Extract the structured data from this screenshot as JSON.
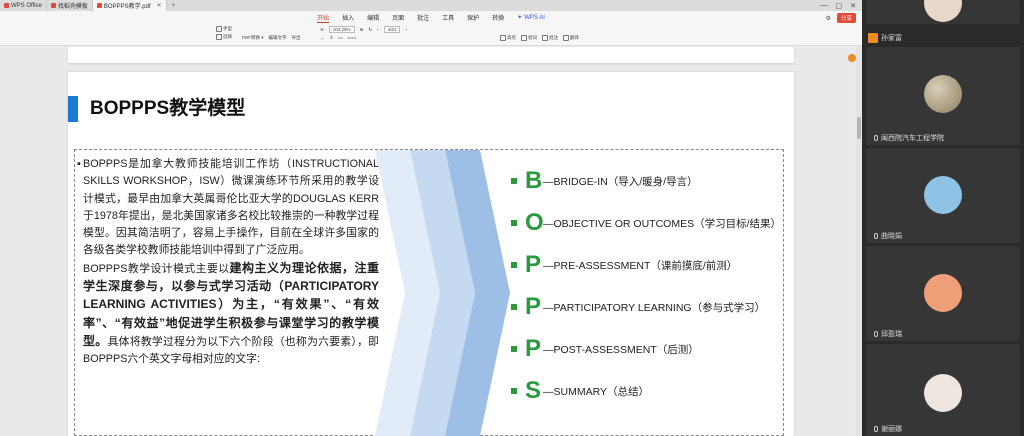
{
  "tabs": [
    {
      "label": "WPS Office",
      "color": "#e24a3a",
      "active": false
    },
    {
      "label": "找稻壳模板",
      "color": "#e24a3a",
      "active": false
    },
    {
      "label": "BOPPPS教学.pdf",
      "color": "#e24a3a",
      "active": true
    }
  ],
  "menu": {
    "items": [
      "开始",
      "插入",
      "编辑",
      "页面",
      "批注",
      "工具",
      "保护",
      "转换"
    ],
    "active": "开始",
    "ai_label": "WPS AI",
    "share_label": "分享"
  },
  "toolbar": {
    "zoom": "103.29%",
    "page": "4/21",
    "labels": [
      "手型",
      "选择",
      "PDF转换",
      "编辑文字",
      "高亮",
      "划词",
      "批注",
      "导出",
      "翻译"
    ]
  },
  "document": {
    "title": "BOPPPS教学模型",
    "paragraph1": "BOPPPS是加拿大教师技能培训工作坊（INSTRUCTIONAL SKILLS WORKSHOP，ISW）微课演练环节所采用的教学设计模式，最早由加拿大英属哥伦比亚大学的DOUGLAS KERR于1978年提出，是北美国家诸多名校比较推崇的一种教学过程模型。因其简洁明了，容易上手操作，目前在全球许多国家的各级各类学校教师技能培训中得到了广泛应用。",
    "paragraph2_lead": "BOPPPS教学设计模式主要以",
    "paragraph2_bold": "建构主义为理论依据，注重学生深度参与，以参与式学习活动（PARTICIPATORY LEARNING ACTIVITIES）为主，“有效果”、“有效率”、“有效益”地促进学生积极参与课堂学习的教学模型。",
    "paragraph2_tail": "具体将教学过程分为以下六个阶段（也称为六要素），即BOPPPS六个英文字母相对应的文字:",
    "stages": [
      {
        "letter": "B",
        "desc": "—BRIDGE-IN（导入/暖身/导言）"
      },
      {
        "letter": "O",
        "desc": "—OBJECTIVE OR OUTCOMES（学习目标/结果）"
      },
      {
        "letter": "P",
        "desc": "—PRE-ASSESSMENT（课前摸底/前测）"
      },
      {
        "letter": "P",
        "desc": "—PARTICIPATORY LEARNING（参与式学习）"
      },
      {
        "letter": "P",
        "desc": "—POST-ASSESSMENT（后测）"
      },
      {
        "letter": "S",
        "desc": "—SUMMARY（总结）"
      }
    ],
    "accent_color": "#2a9a3f",
    "title_bar_color": "#1b7bd0"
  },
  "participants": {
    "self_label": "孙家富",
    "tiles": [
      {
        "name": "",
        "avatar": "portrait"
      },
      {
        "name": "闽西院汽车工程学院",
        "avatar": "beads"
      },
      {
        "name": "曲晓娟",
        "avatar": "cloud"
      },
      {
        "name": "邱盈瑞",
        "avatar": "cartoon"
      },
      {
        "name": "谢丽娜",
        "avatar": "portrait"
      }
    ]
  }
}
